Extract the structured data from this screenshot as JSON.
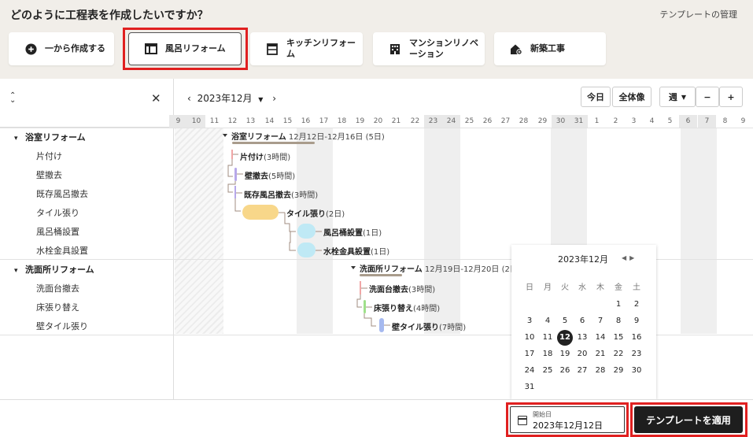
{
  "header": {
    "question": "どのように工程表を作成したいですか？",
    "manage_link": "テンプレートの管理"
  },
  "templates": [
    {
      "label": "一から作成する",
      "icon": "plus-circle-icon"
    },
    {
      "label": "風呂リフォーム",
      "icon": "table-icon"
    },
    {
      "label": "キッチンリフォーム",
      "icon": "kitchen-icon"
    },
    {
      "label": "マンションリノベーション",
      "icon": "building-icon"
    },
    {
      "label": "新築工事",
      "icon": "house-icon"
    }
  ],
  "toolbar": {
    "month": "2023年12月",
    "today": "今日",
    "overview": "全体像",
    "scale": "週",
    "minus": "−",
    "plus": "+"
  },
  "days": [
    "9",
    "10",
    "11",
    "12",
    "13",
    "14",
    "15",
    "16",
    "17",
    "18",
    "19",
    "20",
    "21",
    "22",
    "23",
    "24",
    "25",
    "26",
    "27",
    "28",
    "29",
    "30",
    "31",
    "1",
    "2",
    "3",
    "4",
    "5",
    "6",
    "7",
    "8",
    "9"
  ],
  "tree": {
    "groups": [
      {
        "label": "浴室リフォーム",
        "tasks": [
          "片付け",
          "壁撤去",
          "既存風呂撤去",
          "タイル張り",
          "風呂桶設置",
          "水栓金具設置"
        ]
      },
      {
        "label": "洗面所リフォーム",
        "tasks": [
          "洗面台撤去",
          "床張り替え",
          "壁タイル張り"
        ]
      }
    ]
  },
  "gantt": {
    "group1": {
      "name": "浴室リフォーム",
      "range": "12月12日-12月16日 (5日)"
    },
    "group2": {
      "name": "洗面所リフォーム",
      "range": "12月19日-12月20日 (2日)"
    },
    "tasks": [
      {
        "name": "片付け",
        "dur": "(3時間)"
      },
      {
        "name": "壁撤去",
        "dur": "(5時間)"
      },
      {
        "name": "既存風呂撤去",
        "dur": "(3時間)"
      },
      {
        "name": "タイル張り",
        "dur": "(2日)"
      },
      {
        "name": "風呂桶設置",
        "dur": "(1日)"
      },
      {
        "name": "水栓金具設置",
        "dur": "(1日)"
      },
      {
        "name": "洗面台撤去",
        "dur": "(3時間)"
      },
      {
        "name": "床張り替え",
        "dur": "(4時間)"
      },
      {
        "name": "壁タイル張り",
        "dur": "(7時間)"
      }
    ]
  },
  "calendar": {
    "title": "2023年12月",
    "weekdays": [
      "日",
      "月",
      "火",
      "水",
      "木",
      "金",
      "土"
    ],
    "days": [
      "1",
      "2",
      "3",
      "4",
      "5",
      "6",
      "7",
      "8",
      "9",
      "10",
      "11",
      "12",
      "13",
      "14",
      "15",
      "16",
      "17",
      "18",
      "19",
      "20",
      "21",
      "22",
      "23",
      "24",
      "25",
      "26",
      "27",
      "28",
      "29",
      "30",
      "31"
    ],
    "selected": "12"
  },
  "footer": {
    "start_label": "開始日",
    "start_value": "2023年12月12日",
    "apply": "テンプレートを適用"
  },
  "colors": {
    "selected_frame": "#e02020",
    "apply_bg": "#1e1e1e",
    "tile_bar": "#f8d78a",
    "tub_bar": "#bfe9f5"
  }
}
